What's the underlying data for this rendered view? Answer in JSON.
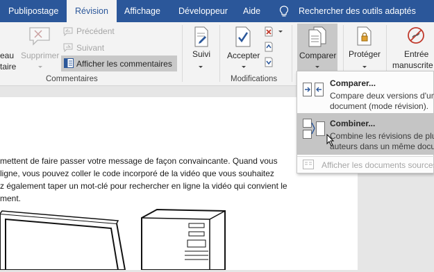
{
  "tabs": [
    {
      "label": "Publipostage",
      "active": false
    },
    {
      "label": "Révision",
      "active": true
    },
    {
      "label": "Affichage",
      "active": false
    },
    {
      "label": "Développeur",
      "active": false
    },
    {
      "label": "Aide",
      "active": false
    }
  ],
  "search": {
    "label": "Rechercher des outils adaptés",
    "icon": "lightbulb-icon"
  },
  "ribbon": {
    "left_cut": {
      "line1": "eau",
      "line2": "taire"
    },
    "comments": {
      "delete_label": "Supprimer",
      "previous_label": "Précédent",
      "next_label": "Suivant",
      "show_comments_label": "Afficher les commentaires",
      "group_label": "Commentaires"
    },
    "tracking": {
      "label": "Suivi"
    },
    "changes": {
      "accept_label": "Accepter",
      "group_label": "Modifications"
    },
    "compare": {
      "label": "Comparer"
    },
    "protect": {
      "label": "Protéger"
    },
    "ink": {
      "line1": "Entrée",
      "line2": "manuscrite"
    }
  },
  "dropdown": {
    "items": [
      {
        "title": "Comparer...",
        "desc1": "Compare deux versions d'un",
        "desc2": "document (mode révision).",
        "icon": "compare-icon"
      },
      {
        "title": "Combiner...",
        "desc1": "Combine les révisions de plu",
        "desc2": "auteurs dans un même docu",
        "icon": "combine-icon"
      },
      {
        "label": "Afficher les documents sources",
        "icon": "source-documents-icon",
        "disabled": true
      }
    ]
  },
  "document": {
    "lines": [
      "mettent de faire passer votre message de façon convaincante. Quand vous",
      "ligne, vous pouvez coller le code incorporé de la vidéo que vous souhaitez",
      "z également taper un mot-clé pour rechercher en ligne la vidéo qui convient le",
      "ment."
    ]
  },
  "colors": {
    "tab_bar": "#2b579a",
    "ribbon": "#f3f3f3",
    "hover": "#c5c5c5",
    "accept_check": "#2b579a",
    "reject_x": "#c0392b"
  }
}
